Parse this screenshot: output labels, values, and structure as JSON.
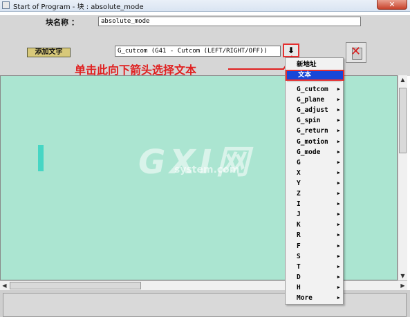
{
  "window": {
    "title": "Start of Program - 块 : absolute_mode",
    "close_label": "✕"
  },
  "block": {
    "label": "块名称 ：",
    "value": "absolute_mode"
  },
  "toolbar": {
    "add_text_label": "添加文字",
    "gcode_select_value": "G_cutcom (G41 - Cutcom (LEFT/RIGHT/OFF))",
    "dropdown_arrow": "⬇"
  },
  "annotation": {
    "text": "单击此向下箭头选择文本"
  },
  "watermark": {
    "main": "GXI网",
    "sub": "system.com"
  },
  "menu": {
    "items": [
      {
        "label": "新地址",
        "submenu": false
      },
      {
        "label": "文本",
        "submenu": false,
        "selected": true
      },
      {
        "label": "G_cutcom",
        "submenu": true
      },
      {
        "label": "G_plane",
        "submenu": true
      },
      {
        "label": "G_adjust",
        "submenu": true
      },
      {
        "label": "G_spin",
        "submenu": true
      },
      {
        "label": "G_return",
        "submenu": true
      },
      {
        "label": "G_motion",
        "submenu": true
      },
      {
        "label": "G_mode",
        "submenu": true
      },
      {
        "label": "G",
        "submenu": true
      },
      {
        "label": "X",
        "submenu": true
      },
      {
        "label": "Y",
        "submenu": true
      },
      {
        "label": "Z",
        "submenu": true
      },
      {
        "label": "I",
        "submenu": true
      },
      {
        "label": "J",
        "submenu": true
      },
      {
        "label": "K",
        "submenu": true
      },
      {
        "label": "R",
        "submenu": true
      },
      {
        "label": "F",
        "submenu": true
      },
      {
        "label": "S",
        "submenu": true
      },
      {
        "label": "T",
        "submenu": true
      },
      {
        "label": "D",
        "submenu": true
      },
      {
        "label": "H",
        "submenu": true
      },
      {
        "label": "More",
        "submenu": true
      }
    ]
  },
  "colors": {
    "workspace": "#abe5d1",
    "selection": "#1847d8",
    "annotation": "#e02020",
    "button": "#d8c97a"
  }
}
